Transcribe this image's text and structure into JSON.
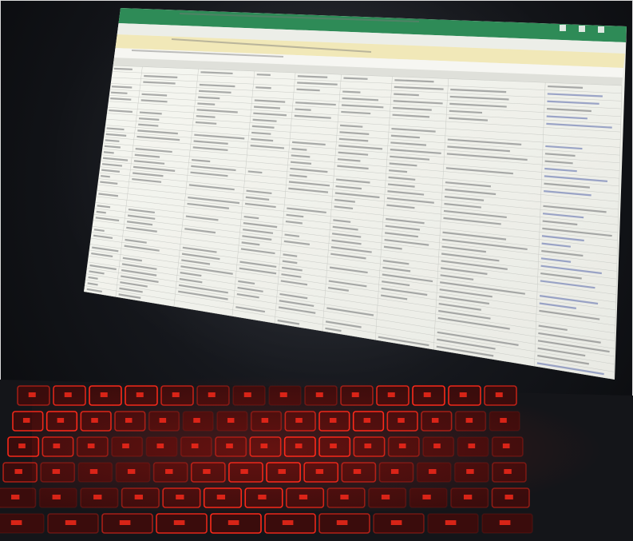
{
  "photo": {
    "subject": "laptop-screen-with-spreadsheet",
    "colors": {
      "titlebar": "#2e8b57",
      "sheet_bg": "#f3f4ef",
      "sheet_header": "#e6e7e1",
      "banner": "#f1e8b8",
      "grid_line": "#c9cbc6",
      "key_glow": "#ff2a1a",
      "key_cap": "#3a0c0c"
    }
  },
  "screen": {
    "visible_text_legible": false,
    "rows": 38,
    "columns": 9
  },
  "keyboard": {
    "backlight": "red"
  }
}
